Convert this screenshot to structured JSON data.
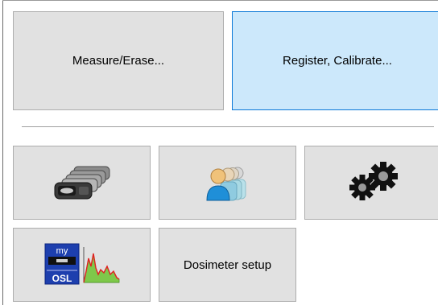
{
  "buttons": {
    "measure_erase": "Measure/Erase...",
    "register_calibrate": "Register, Calibrate...",
    "dosimeter_setup": "Dosimeter setup"
  },
  "icons": {
    "dosimeters": "dosimeter-stack-icon",
    "users": "user-group-icon",
    "settings": "gears-icon",
    "myosl": "myosl-reader-chart-icon"
  },
  "logo_text": {
    "top": "my",
    "bottom": "OSL"
  },
  "colors": {
    "button_bg": "#e1e1e1",
    "button_border": "#adadad",
    "hover_bg": "#cce8fb",
    "hover_border": "#0a78d7"
  }
}
